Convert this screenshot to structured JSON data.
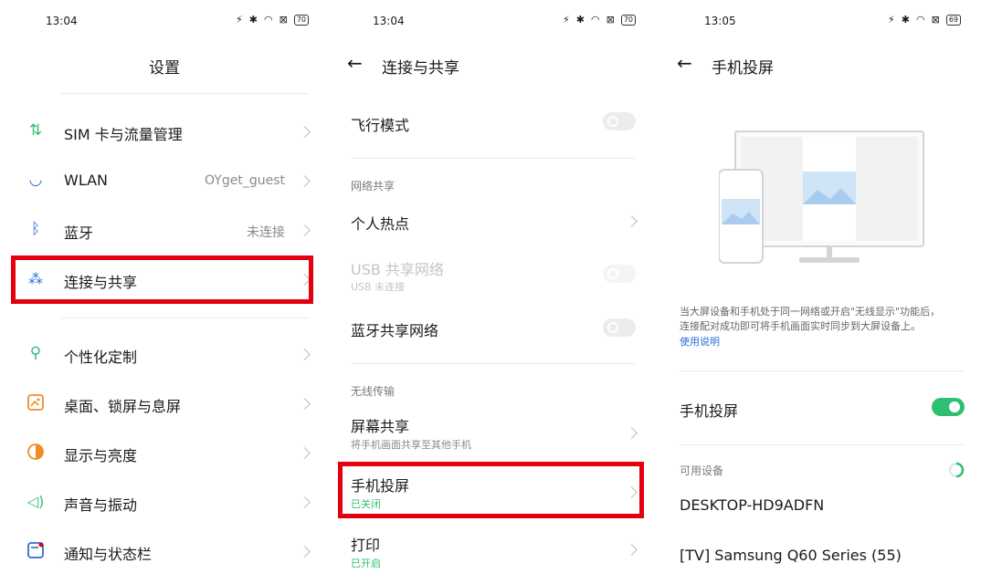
{
  "screen1": {
    "time": "13:04",
    "battery": "70",
    "title": "设置",
    "items": [
      {
        "label": "SIM 卡与流量管理",
        "value": ""
      },
      {
        "label": "WLAN",
        "value": "OYget_guest"
      },
      {
        "label": "蓝牙",
        "value": "未连接"
      },
      {
        "label": "连接与共享",
        "value": ""
      },
      {
        "label": "个性化定制",
        "value": ""
      },
      {
        "label": "桌面、锁屏与息屏",
        "value": ""
      },
      {
        "label": "显示与亮度",
        "value": ""
      },
      {
        "label": "声音与振动",
        "value": ""
      },
      {
        "label": "通知与状态栏",
        "value": ""
      }
    ]
  },
  "screen2": {
    "time": "13:04",
    "battery": "70",
    "title": "连接与共享",
    "airplane": "飞行模式",
    "section_network": "网络共享",
    "hotspot": "个人热点",
    "usb_share": "USB 共享网络",
    "usb_sub": "USB 未连接",
    "bt_share": "蓝牙共享网络",
    "section_wireless": "无线传输",
    "screen_share": "屏幕共享",
    "screen_share_sub": "将手机画面共享至其他手机",
    "cast": "手机投屏",
    "cast_sub": "已关闭",
    "print": "打印",
    "print_sub": "已开启"
  },
  "screen3": {
    "time": "13:05",
    "battery": "69",
    "title": "手机投屏",
    "desc_line1": "当大屏设备和手机处于同一网络或开启\"无线显示\"功能后，",
    "desc_line2": "连接配对成功即可将手机画面实时同步到大屏设备上。",
    "help_link": "使用说明",
    "cast_toggle_label": "手机投屏",
    "available_header": "可用设备",
    "devices": [
      "DESKTOP-HD9ADFN",
      "[TV] Samsung Q60 Series (55)"
    ]
  },
  "colors": {
    "highlight": "#e3000f",
    "accent_green": "#2fbf71",
    "link_blue": "#2a6fd6"
  }
}
